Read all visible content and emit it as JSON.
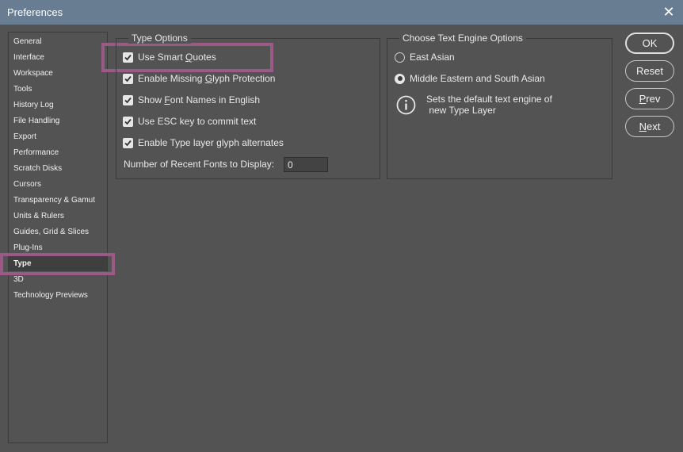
{
  "window": {
    "title": "Preferences",
    "close_glyph": "✕"
  },
  "sidebar": {
    "items": [
      {
        "label": "General"
      },
      {
        "label": "Interface"
      },
      {
        "label": "Workspace"
      },
      {
        "label": "Tools"
      },
      {
        "label": "History Log"
      },
      {
        "label": "File Handling"
      },
      {
        "label": "Export"
      },
      {
        "label": "Performance"
      },
      {
        "label": "Scratch Disks"
      },
      {
        "label": "Cursors"
      },
      {
        "label": "Transparency & Gamut"
      },
      {
        "label": "Units & Rulers"
      },
      {
        "label": "Guides, Grid & Slices"
      },
      {
        "label": "Plug-Ins"
      },
      {
        "label": "Type"
      },
      {
        "label": "3D"
      },
      {
        "label": "Technology Previews"
      }
    ],
    "selected": "Type"
  },
  "type_options": {
    "title": "Type Options",
    "checkboxes": [
      {
        "before": "Use Smart ",
        "ul": "Q",
        "after": "uotes",
        "checked": true
      },
      {
        "before": "Enable Missing ",
        "ul": "G",
        "after": "lyph Protection",
        "checked": true
      },
      {
        "before": "Show ",
        "ul": "F",
        "after": "ont Names in English",
        "checked": true
      },
      {
        "before": "Use ESC key to commit text",
        "ul": "",
        "after": "",
        "checked": true
      },
      {
        "before": "Enable Type layer glyph alternates",
        "ul": "",
        "after": "",
        "checked": true
      }
    ],
    "recent_fonts_label": "Number of Recent Fonts to Display:",
    "recent_fonts_value": "0"
  },
  "text_engine": {
    "title": "Choose Text Engine Options",
    "options": [
      {
        "label": "East Asian",
        "selected": false
      },
      {
        "label": "Middle Eastern and South Asian",
        "selected": true
      }
    ],
    "info_line1": "Sets the default text engine of",
    "info_line2": " new Type Layer"
  },
  "buttons": {
    "ok": "OK",
    "reset": "Reset",
    "prev_ul": "P",
    "prev_rest": "rev",
    "next_ul": "N",
    "next_rest": "ext"
  },
  "colors": {
    "titlebar": "#687d91",
    "panel": "#535353",
    "highlight": "#9b5a86"
  }
}
